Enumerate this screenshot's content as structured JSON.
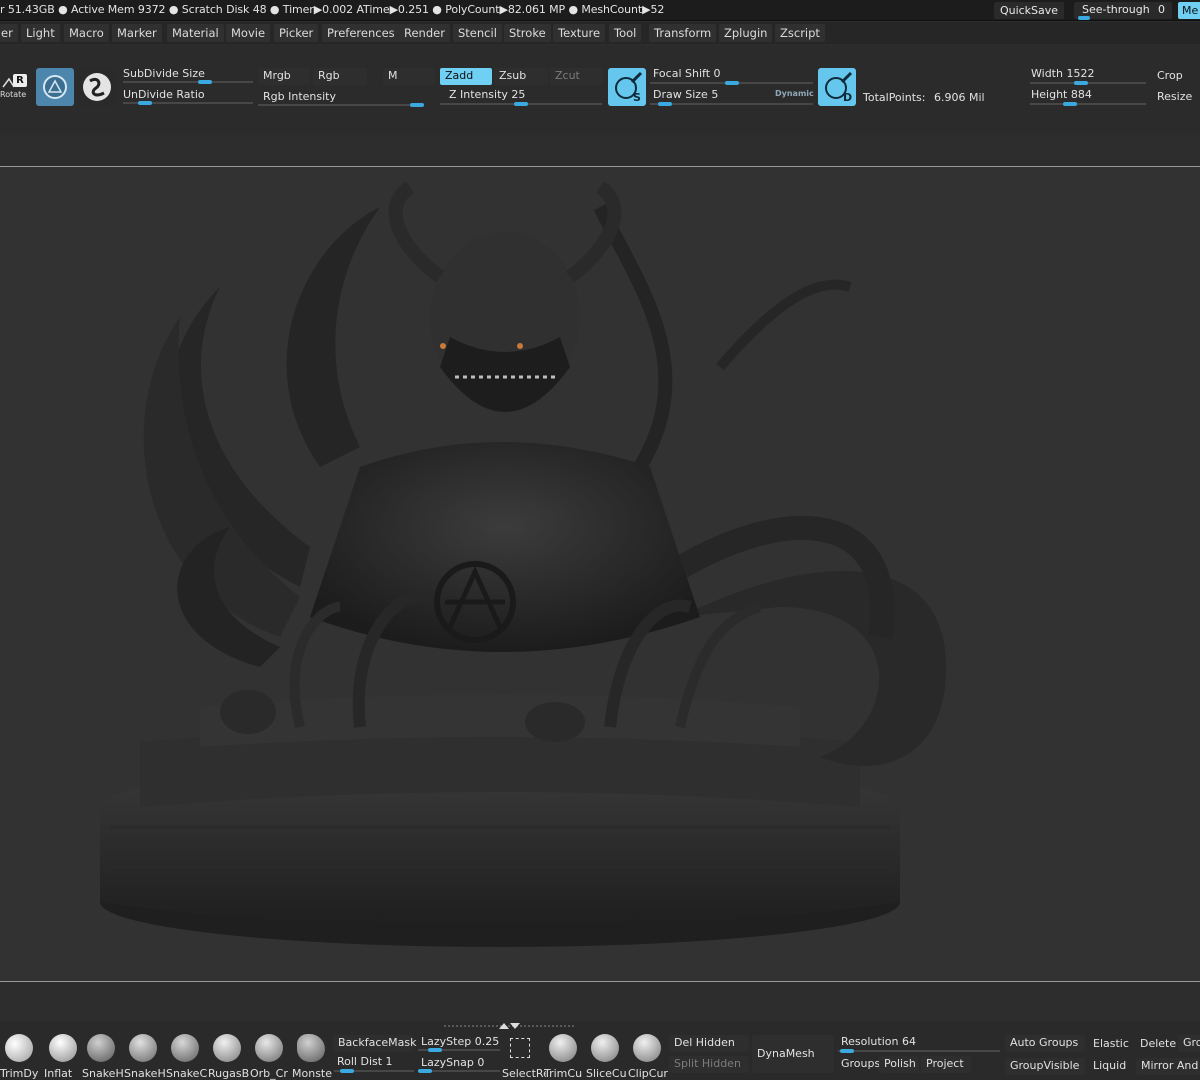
{
  "status_bar": {
    "text": "r 51.43GB ● Active Mem 9372 ● Scratch Disk 48 ●  Timer▶0.002 ATime▶0.251 ● PolyCount▶82.061 MP  ● MeshCount▶52",
    "quicksave": "QuickSave",
    "see_through_label": "See-through",
    "see_through_value": "0",
    "menu_btn": "Me"
  },
  "menus": [
    "er",
    "Light",
    "Macro",
    "Marker",
    "Material",
    "Movie",
    "Picker",
    "Preferences",
    "Render",
    "Stencil",
    "Stroke",
    "Texture",
    "Tool",
    "Transform",
    "Zplugin",
    "Zscript"
  ],
  "shelf": {
    "rotate_label": "Rotate",
    "rotate_key": "R",
    "subdivide_size": "SubDivide Size",
    "undivide_ratio": "UnDivide Ratio",
    "mrgb": "Mrgb",
    "rgb": "Rgb",
    "m": "M",
    "rgb_intensity": "Rgb Intensity",
    "zadd": "Zadd",
    "zsub": "Zsub",
    "zcut": "Zcut",
    "z_intensity_label": "Z Intensity",
    "z_intensity_value": "25",
    "focal_shift_label": "Focal Shift",
    "focal_shift_value": "0",
    "draw_size_label": "Draw Size",
    "draw_size_value": "5",
    "dynamic": "Dynamic",
    "s_key": "S",
    "d_key": "D",
    "total_points_label": "TotalPoints:",
    "total_points_value": "6.906 Mil",
    "width_label": "Width",
    "width_value": "1522",
    "height_label": "Height",
    "height_value": "884",
    "crop": "Crop",
    "resize": "Resize"
  },
  "bottom": {
    "brushes": [
      "TrimDy",
      "Inflat",
      "SnakeH",
      "SnakeH",
      "SnakeC",
      "RugasB",
      "Orb_Cr",
      "Monste"
    ],
    "backface_mask": "BackfaceMask",
    "roll_dist": "Roll Dist 1",
    "lazystep": "LazyStep 0.25",
    "lazysnap": "LazySnap 0",
    "tools": [
      "SelectRe",
      "TrimCu",
      "SliceCu",
      "ClipCur"
    ],
    "del_hidden": "Del Hidden",
    "split_hidden": "Split Hidden",
    "dynamesh": "DynaMesh",
    "resolution": "Resolution 64",
    "groups": "Groups",
    "polish": "Polish",
    "project": "Project",
    "auto_groups": "Auto Groups",
    "group_visible": "GroupVisible",
    "elastic": "Elastic",
    "liquid": "Liquid",
    "delete": "Delete",
    "mirror_and": "Mirror And",
    "grc": "Grc"
  },
  "colors": {
    "accent": "#6fd0f4",
    "slider": "#3aa9e0",
    "canvas": "#323232",
    "panel": "#2b2b2b"
  }
}
